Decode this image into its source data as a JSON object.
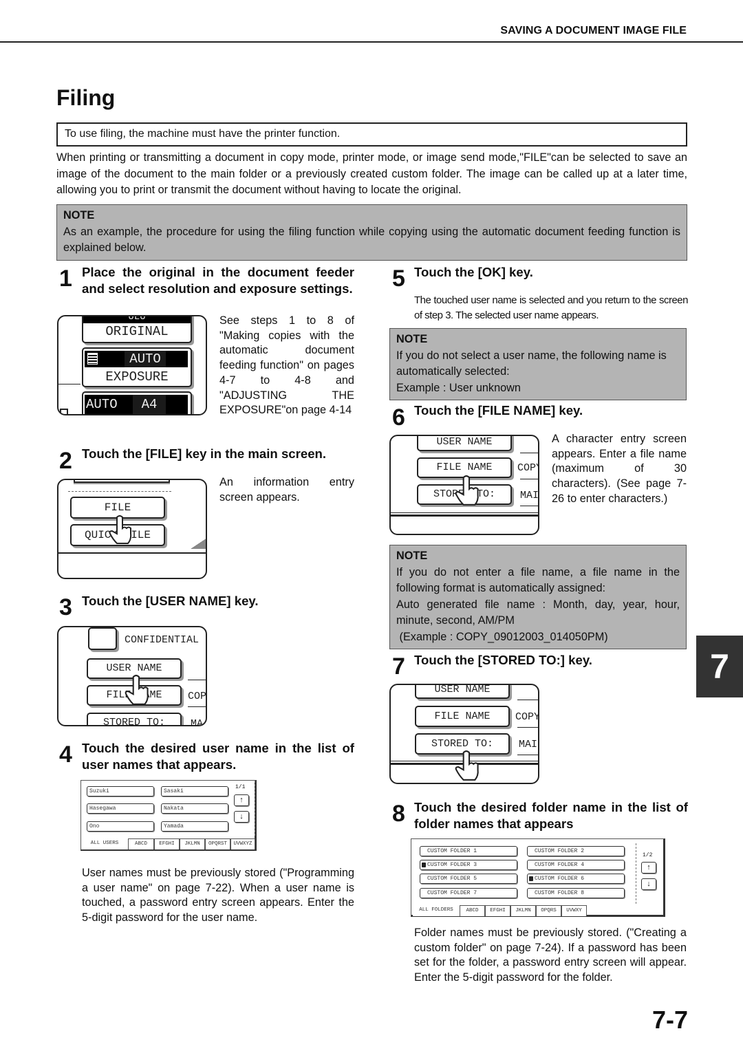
{
  "running_header": "SAVING A DOCUMENT IMAGE FILE",
  "page_title": "Filing",
  "requirement": "To use filing, the machine must have the printer function.",
  "intro": "When printing or transmitting a document in copy mode, printer mode, or image send mode,\"FILE\"can be selected to save an image of the document to the main folder or a previously created custom folder. The image can be called up at a later time, allowing you to print or transmit the document without having to locate the original.",
  "note_top": {
    "heading": "NOTE",
    "text": "As an example, the procedure for using the filing function while copying using the automatic document feeding function is explained below."
  },
  "steps": [
    {
      "num": "1",
      "title": "Place the original in the document feeder and select resolution and exposure settings.",
      "body": "See steps 1 to 8 of \"Making copies with the automatic document feeding function\" on pages 4-7 to 4-8 and \"ADJUSTING THE EXPOSURE\"on page 4-14",
      "screen": {
        "top_partial": "ULU",
        "original": "ORIGINAL",
        "exposure_value": "AUTO",
        "exposure": "EXPOSURE",
        "paper_mode": "AUTO",
        "paper_size": "A4"
      }
    },
    {
      "num": "2",
      "title": "Touch the [FILE] key in the main screen.",
      "body": "An information entry screen appears.",
      "screen": {
        "file_key": "FILE",
        "quick_file_key": "QUICK FILE"
      }
    },
    {
      "num": "3",
      "title": "Touch the [USER NAME] key.",
      "screen": {
        "confidential": "CONFIDENTIAL",
        "user_name": "USER NAME",
        "file_name": "FILE NAME",
        "file_value": "COP",
        "stored_to": "STORED TO:",
        "stored_value": "MA"
      }
    },
    {
      "num": "4",
      "title": "Touch the desired user name in the list of user names that appears.",
      "body": "User names must be previously stored (\"Programming a user name\" on page 7-22). When a user name is touched, a password entry screen appears. Enter the 5-digit password for the user name.",
      "screen": {
        "users": [
          "Suzuki",
          "Sasaki",
          "Hasegawa",
          "Nakata",
          "Ono",
          "Yamada"
        ],
        "page": "1/1",
        "tabs": [
          "ALL USERS",
          "ABCD",
          "EFGHI",
          "JKLMN",
          "OPQRST",
          "UVWXYZ"
        ]
      }
    },
    {
      "num": "5",
      "title": "Touch the [OK] key.",
      "body": "The touched user name is selected and you return to the screen of step 3. The selected user name appears.",
      "note": {
        "heading": "NOTE",
        "lines": [
          "If you do not select a user name, the following name is automatically selected:",
          "Example : User unknown"
        ]
      }
    },
    {
      "num": "6",
      "title": "Touch the [FILE NAME] key.",
      "body": "A character entry screen appears. Enter a file name (maximum of 30 characters). (See page 7-26 to enter characters.)",
      "screen": {
        "user_name": "USER NAME",
        "file_name": "FILE NAME",
        "file_value": "COPY",
        "stored_to": "STORED TO:",
        "stored_value": "MAI"
      },
      "note": {
        "heading": "NOTE",
        "lines": [
          "If you do not enter a file name, a file name in the following format is automatically assigned:",
          "Auto generated file name : Month, day, year, hour, minute, second, AM/PM",
          " (Example : COPY_09012003_014050PM)"
        ]
      }
    },
    {
      "num": "7",
      "title": "Touch the [STORED TO:] key.",
      "screen": {
        "user_name": "USER NAME",
        "file_name": "FILE NAME",
        "file_value": "COPY",
        "stored_to": "STORED TO:",
        "stored_value": "MAI"
      }
    },
    {
      "num": "8",
      "title": "Touch the desired folder name in the list of folder names that appears",
      "body": "Folder names must be previously stored. (\"Creating a custom folder\" on page 7-24). If a password has been set for the folder, a password entry screen will appear. Enter the 5-digit password for the folder.",
      "screen": {
        "folders": [
          {
            "name": "CUSTOM FOLDER 1",
            "locked": false
          },
          {
            "name": "CUSTOM FOLDER 2",
            "locked": false
          },
          {
            "name": "CUSTOM FOLDER 3",
            "locked": true
          },
          {
            "name": "CUSTOM FOLDER 4",
            "locked": false
          },
          {
            "name": "CUSTOM FOLDER 5",
            "locked": false
          },
          {
            "name": "CUSTOM FOLDER 6",
            "locked": true
          },
          {
            "name": "CUSTOM FOLDER 7",
            "locked": false
          },
          {
            "name": "CUSTOM FOLDER 8",
            "locked": false
          }
        ],
        "page": "1/2",
        "tabs": [
          "ALL FOLDERS",
          "ABCD",
          "EFGHI",
          "JKLMN",
          "OPQRS",
          "UVWXY"
        ]
      }
    }
  ],
  "icons": {
    "up": "↑",
    "down": "↓",
    "lock": "🔒"
  },
  "chapter_tab": "7",
  "page_number": "7-7"
}
